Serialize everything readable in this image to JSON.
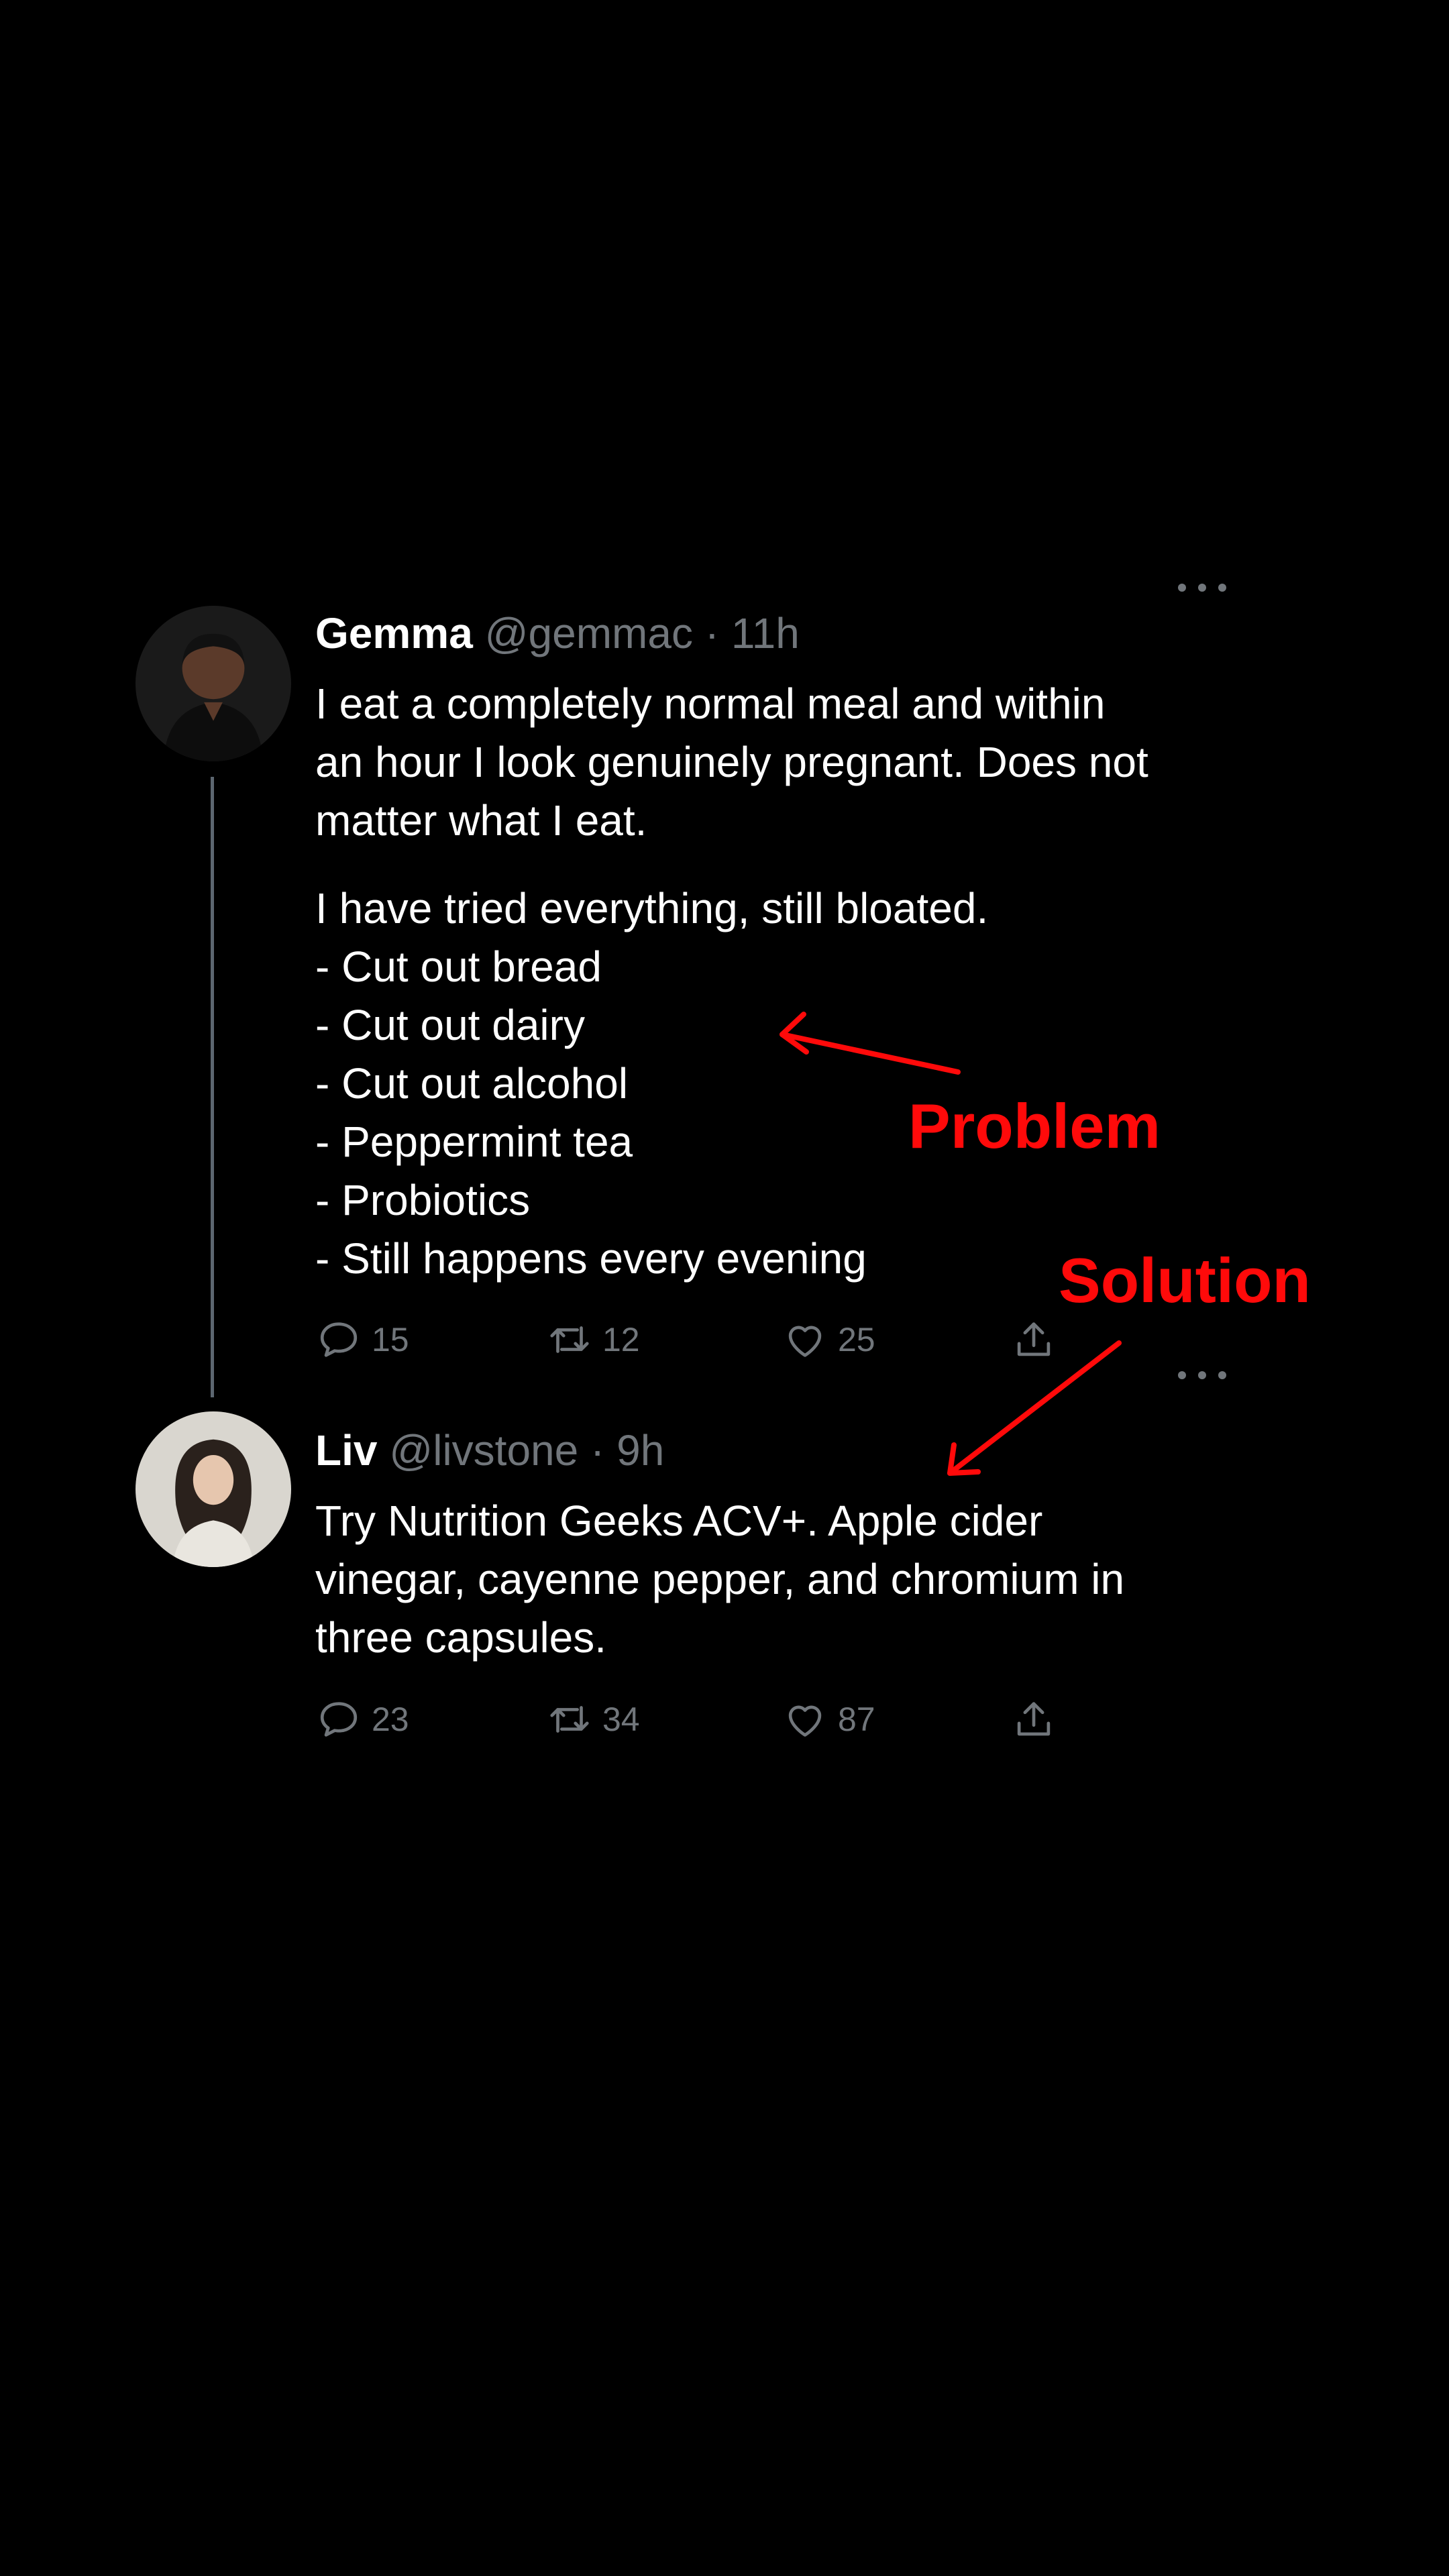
{
  "tweets": [
    {
      "name": "Gemma",
      "handle": "@gemmac",
      "time": "11h",
      "text": "I eat a completely normal meal and within\nan hour I look genuinely pregnant. Does not\nmatter what I eat.",
      "list_intro": "I have tried everything, still bloated.",
      "list": [
        "- Cut out bread",
        "- Cut out dairy",
        "- Cut out alcohol",
        "- Peppermint tea",
        "- Probiotics",
        "- Still happens every evening"
      ],
      "replies": "15",
      "retweets": "12",
      "likes": "25"
    },
    {
      "name": "Liv",
      "handle": "@livstone",
      "time": "9h",
      "text": "Try Nutrition Geeks ACV+. Apple cider\nvinegar, cayenne pepper, and chromium in\nthree capsules.",
      "replies": "23",
      "retweets": "34",
      "likes": "87"
    }
  ],
  "separator": "·",
  "annotations": {
    "problem": "Problem",
    "solution": "Solution"
  },
  "colors": {
    "background": "#000000",
    "text": "#ffffff",
    "muted": "#71767b",
    "annotation": "#ff0a0a"
  },
  "icons": [
    "reply-icon",
    "retweet-icon",
    "like-icon",
    "share-icon",
    "more-options-icon"
  ]
}
